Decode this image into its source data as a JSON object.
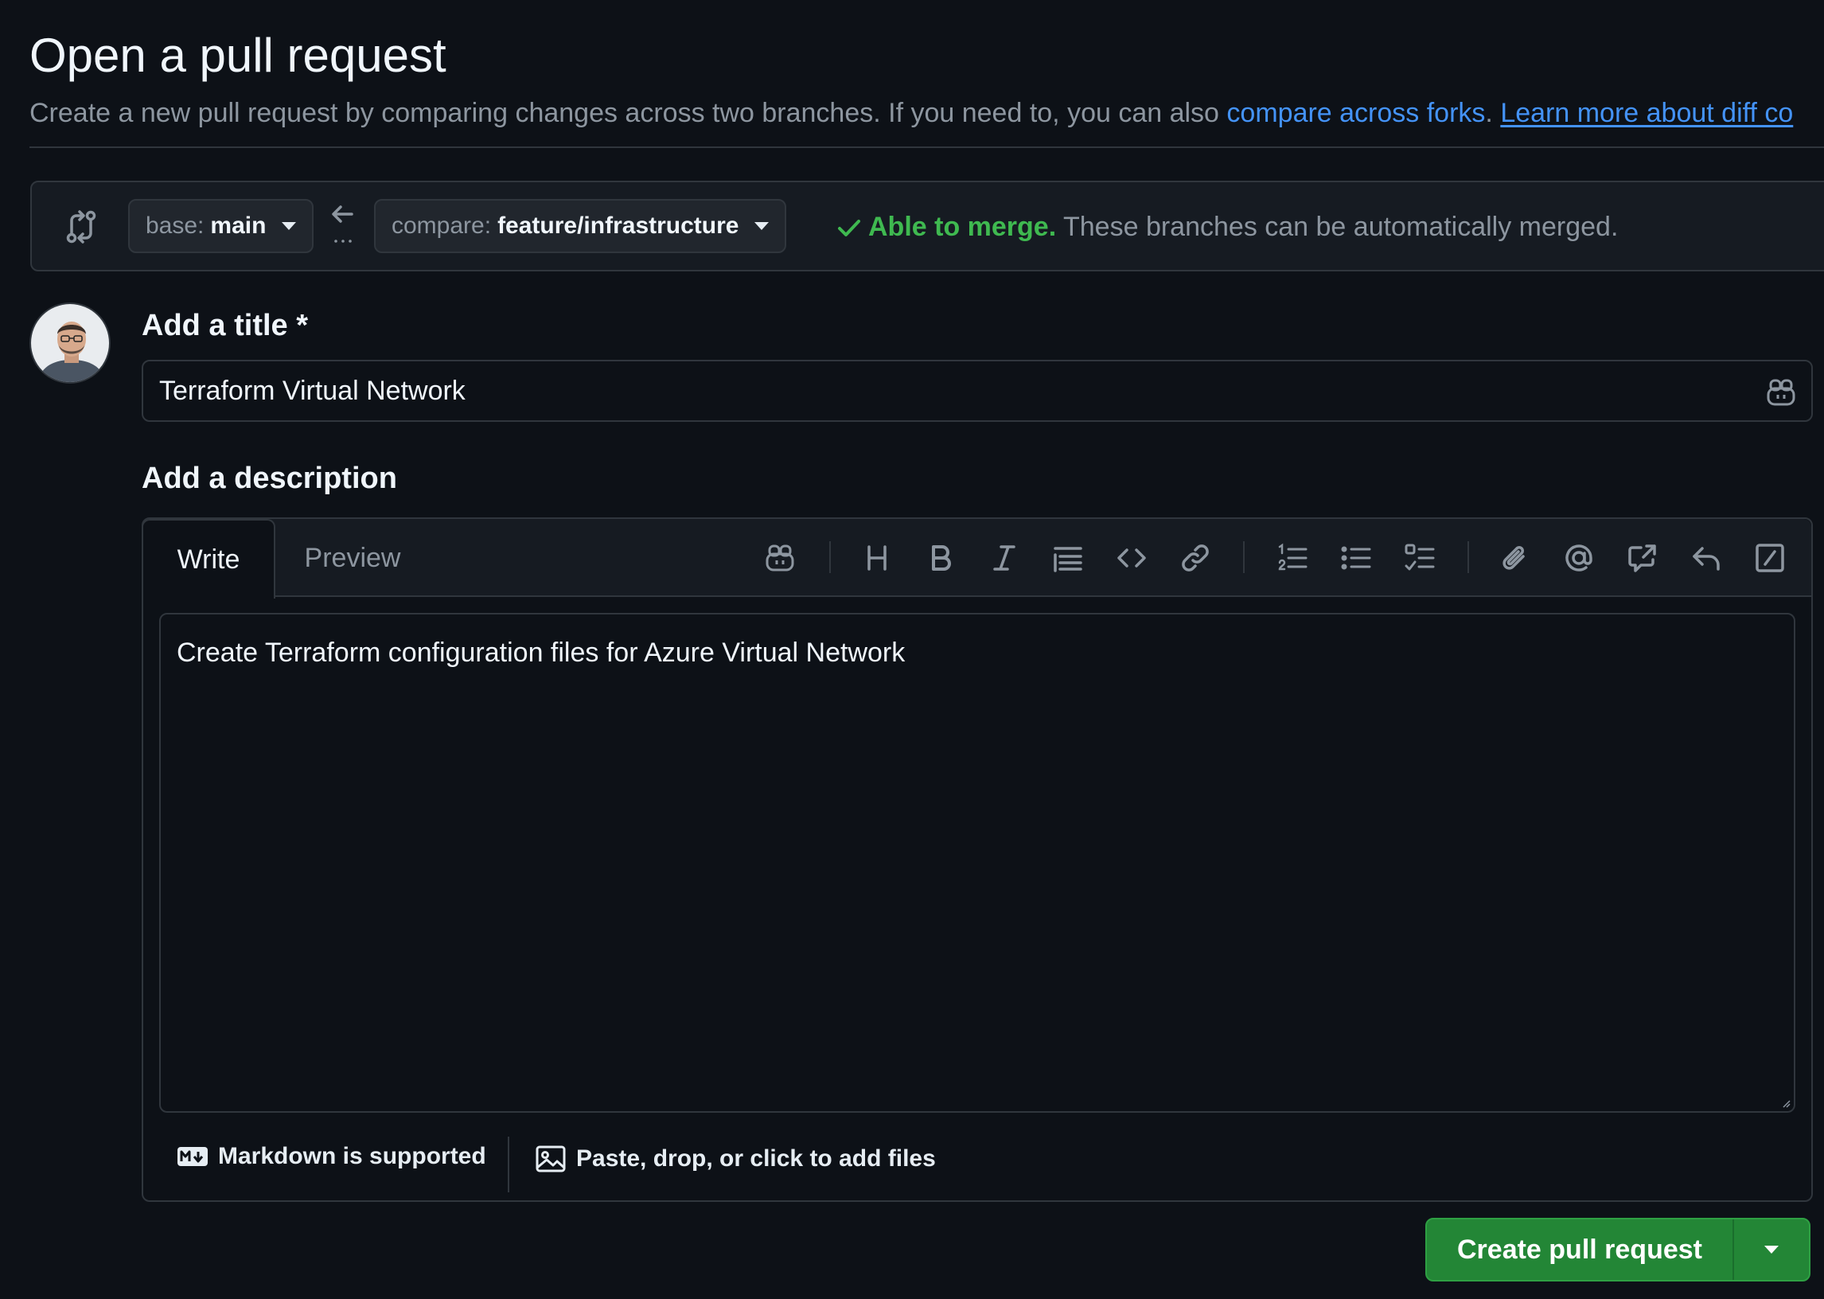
{
  "header": {
    "title": "Open a pull request",
    "subtitle_text": "Create a new pull request by comparing changes across two branches. If you need to, you can also ",
    "compare_forks_link": "compare across forks",
    "subtitle_sep": ". ",
    "learn_more_link": "Learn more about diff co"
  },
  "compare": {
    "base_key": "base:",
    "base_value": "main",
    "compare_key": "compare:",
    "compare_value": "feature/infrastructure",
    "merge_ok": "Able to merge.",
    "merge_text": " These branches can be automatically merged."
  },
  "title_section": {
    "label": "Add a title *",
    "value": "Terraform Virtual Network"
  },
  "description": {
    "label": "Add a description",
    "tabs": [
      "Write",
      "Preview"
    ],
    "body": "Create Terraform configuration files for Azure Virtual Network",
    "markdown_note": "Markdown is supported",
    "attach_note": "Paste, drop, or click to add files"
  },
  "toolbar_icons": [
    "copilot-icon",
    "heading-icon",
    "bold-icon",
    "italic-icon",
    "quote-icon",
    "code-icon",
    "link-icon",
    "ordered-list-icon",
    "unordered-list-icon",
    "task-list-icon",
    "attach-icon",
    "mention-icon",
    "reference-icon",
    "reply-icon",
    "slash-command-icon"
  ],
  "actions": {
    "create_label": "Create pull request"
  },
  "colors": {
    "background": "#0d1117",
    "accent_link": "#4493f8",
    "success": "#3fb950",
    "primary_button": "#238636"
  }
}
